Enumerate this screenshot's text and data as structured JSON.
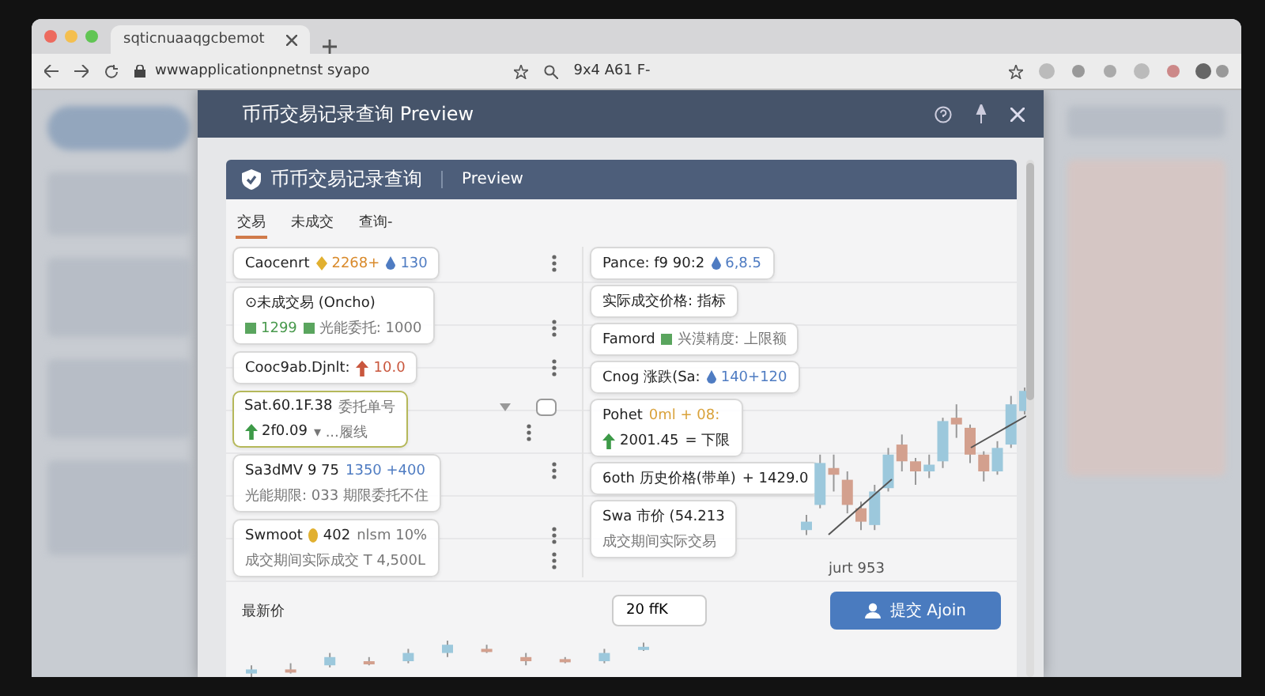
{
  "browser": {
    "tab_title": "sqticnuaaqgcbemot",
    "address": "wwwapplicationpnetnst syapo",
    "address_extra": "9x4 A61 F-"
  },
  "modal": {
    "title": "币币交易记录查询 Preview",
    "panel": {
      "title": "币币交易记录查询",
      "subtitle": "Preview"
    },
    "tabs": [
      {
        "label": "交易",
        "selected": true
      },
      {
        "label": "未成交",
        "selected": false
      },
      {
        "label": "查询-",
        "selected": false
      }
    ],
    "left_cards": [
      {
        "selected": false,
        "lines": [
          {
            "menu": true,
            "parts": [
              {
                "kind": "plain",
                "text": "Caocenrt"
              },
              {
                "kind": "diamond",
                "text": "2268+",
                "color": "#d98a2b"
              },
              {
                "kind": "drop",
                "text": "130",
                "color": "#4f7cc2"
              }
            ]
          }
        ]
      },
      {
        "selected": false,
        "lines": [
          {
            "menu": false,
            "parts": [
              {
                "kind": "plain",
                "text": "⊙未成交易 (Oncho)"
              }
            ]
          },
          {
            "menu": true,
            "parts": [
              {
                "kind": "square",
                "text": "1299",
                "color": "#4a9a4e"
              },
              {
                "kind": "square",
                "text": "光能委托: 1000",
                "color": "#777777"
              }
            ]
          }
        ]
      },
      {
        "selected": false,
        "lines": [
          {
            "menu": true,
            "parts": [
              {
                "kind": "plain",
                "text": "Cooc9ab.Djnlt:"
              },
              {
                "kind": "arrow",
                "text": "10.0",
                "color": "#c9573e"
              }
            ]
          }
        ]
      },
      {
        "selected": true,
        "lines": [
          {
            "menu": false,
            "parts": [
              {
                "kind": "plain",
                "text": "Sat.60.1F.38"
              },
              {
                "kind": "plain",
                "text": "委托单号",
                "color": "#777777"
              }
            ]
          },
          {
            "menu": true,
            "parts": [
              {
                "kind": "arrow",
                "text": "2f0.09",
                "color": "#222222"
              },
              {
                "kind": "plain",
                "text": "▾ ...履线",
                "color": "#777777"
              }
            ]
          }
        ]
      },
      {
        "selected": false,
        "lines": [
          {
            "menu": true,
            "parts": [
              {
                "kind": "plain",
                "text": "Sa3dMV 9 75"
              },
              {
                "kind": "plain",
                "text": "1350 +400",
                "color": "#4f7cc2"
              }
            ]
          },
          {
            "menu": false,
            "parts": [
              {
                "kind": "plain",
                "text": "光能期限: 033 期限委托不住",
                "color": "#777777"
              }
            ]
          }
        ]
      },
      {
        "selected": false,
        "lines": [
          {
            "menu": true,
            "parts": [
              {
                "kind": "plain",
                "text": "Swmoot"
              },
              {
                "kind": "dot",
                "text": "402"
              },
              {
                "kind": "plain",
                "text": "nlsm 10%",
                "color": "#777777"
              }
            ]
          },
          {
            "menu": true,
            "parts": [
              {
                "kind": "plain",
                "text": "成交期间实际成交 T 4,500L",
                "color": "#777777"
              }
            ]
          }
        ]
      }
    ],
    "right_cards": [
      {
        "lines": [
          {
            "parts": [
              {
                "kind": "plain",
                "text": "Pance: f9 90:2"
              },
              {
                "kind": "drop",
                "text": "6,8.5",
                "color": "#4f7cc2"
              }
            ]
          }
        ]
      },
      {
        "lines": [
          {
            "parts": [
              {
                "kind": "plain",
                "text": "实际成交价格: 指标"
              }
            ]
          }
        ]
      },
      {
        "lines": [
          {
            "parts": [
              {
                "kind": "plain",
                "text": "Famord"
              },
              {
                "kind": "square",
                "text": "兴漠精度: 上限额",
                "color": "#777777"
              }
            ]
          }
        ]
      },
      {
        "lines": [
          {
            "parts": [
              {
                "kind": "plain",
                "text": "Cnog 涨跌(Sa:"
              },
              {
                "kind": "drop",
                "text": "140+120",
                "color": "#4f7cc2"
              }
            ]
          }
        ]
      },
      {
        "lines": [
          {
            "parts": [
              {
                "kind": "plain",
                "text": "Pohet"
              },
              {
                "kind": "plain",
                "text": "0ml + 08:",
                "color": "#d9a23a"
              }
            ]
          },
          {
            "parts": [
              {
                "kind": "arrow",
                "text": "2001.45",
                "color": "#222222"
              },
              {
                "kind": "plain",
                "text": "= 下限"
              }
            ]
          }
        ]
      },
      {
        "lines": [
          {
            "parts": [
              {
                "kind": "plain",
                "text": "6oth 历史价格(带单)"
              },
              {
                "kind": "plain",
                "text": "+ 1429.0"
              }
            ]
          }
        ]
      },
      {
        "lines": [
          {
            "parts": [
              {
                "kind": "plain",
                "text": "Swa 市价 (54.213"
              }
            ]
          },
          {
            "parts": [
              {
                "kind": "plain",
                "text": "成交期间实际交易",
                "color": "#777777"
              }
            ]
          }
        ]
      }
    ],
    "chart_note": "jurt 953",
    "price": {
      "label": "最新价",
      "value": "20 ffK"
    },
    "submit": "提交 Ajoin"
  }
}
